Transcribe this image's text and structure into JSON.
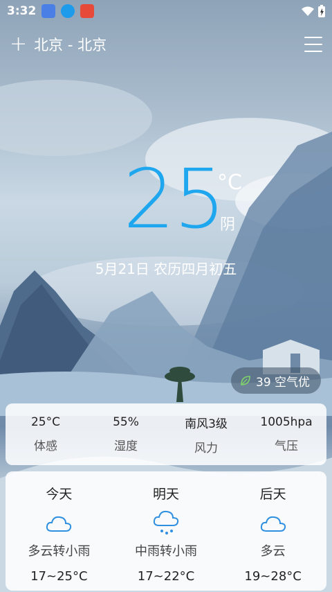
{
  "status": {
    "time": "3:32"
  },
  "header": {
    "city": "北京 - 北京"
  },
  "current": {
    "temperature": "25",
    "unit": "°C",
    "condition": "阴",
    "date": "5月21日 农历四月初五"
  },
  "aqi": {
    "label": "39 空气优"
  },
  "details": [
    {
      "value": "25°C",
      "label": "体感"
    },
    {
      "value": "55%",
      "label": "湿度"
    },
    {
      "value": "南风3级",
      "label": "风力"
    },
    {
      "value": "1005hpa",
      "label": "气压"
    }
  ],
  "forecast": [
    {
      "day": "今天",
      "icon": "cloud-icon",
      "desc": "多云转小雨",
      "range": "17~25°C"
    },
    {
      "day": "明天",
      "icon": "rain-icon",
      "desc": "中雨转小雨",
      "range": "17~22°C"
    },
    {
      "day": "后天",
      "icon": "cloud-icon",
      "desc": "多云",
      "range": "19~28°C"
    }
  ],
  "colors": {
    "temp": "#1ea7ee",
    "icon": "#2f8fe0"
  }
}
